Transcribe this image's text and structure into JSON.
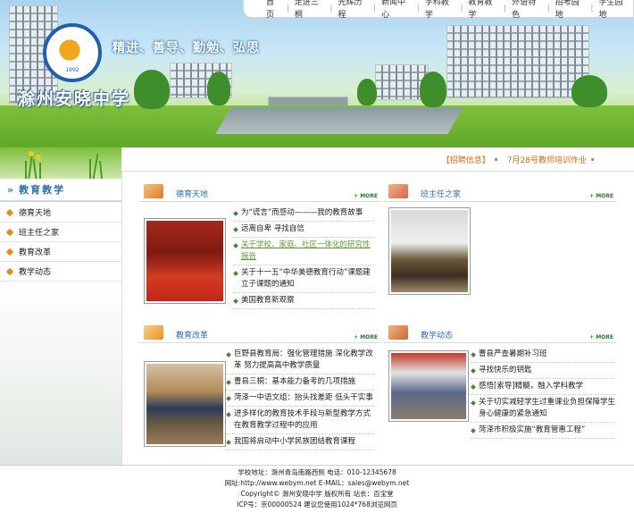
{
  "header": {
    "motto": "精进、善导、勤勉、弘思",
    "school_name": "滁州安晓中学",
    "logo_year": "1992"
  },
  "top_nav": [
    "首页",
    "走进三桐",
    "光辉历程",
    "新闻中心",
    "学科教学",
    "教育教学",
    "外语特色",
    "招考园地",
    "学生园地"
  ],
  "notice": {
    "label": "【招聘信息】",
    "item": "7月28号教师培训作业"
  },
  "sidebar": {
    "title": "教育教学",
    "items": [
      "德育天地",
      "班主任之家",
      "教育改革",
      "教学动态"
    ]
  },
  "sections": {
    "deyu": {
      "title": "德育天地",
      "more": "MORE",
      "items": [
        "为“谎言”而感动———我的教育故事",
        "远离自卑 寻找自信",
        "关于学校、家庭、社区一体化的研究性报告",
        "关于十一五“中华美德教育行动”课题建立子课题的通知",
        "美国教育新观察"
      ]
    },
    "banzhuren": {
      "title": "班主任之家",
      "more": "MORE"
    },
    "gaige": {
      "title": "教育改革",
      "more": "MORE",
      "items": [
        "巨野县教育局：强化管理措施 深化教学改革 努力提高高中教学质量",
        "曹县三桐：基本能力备考的几项措施",
        "菏泽一中语文组：抬头找差距 低头干实事",
        "进多样化的教育技术手段与新型教学方式在教育教学过程中的应用",
        "我国将启动中小学民族团结教育课程"
      ]
    },
    "dongtai": {
      "title": "教学动态",
      "more": "MORE",
      "items": [
        "曹县严查暑期补习班",
        "寻找快乐的钥匙",
        "感悟[索导]精髓，融入学科教学",
        "关于切实减轻学生过重课业负担保障学生身心健康的紧急通知",
        "菏泽市积极实施“教育管惠工程”"
      ]
    }
  },
  "footer": {
    "line1": "学校地址：滁州青岛南路西侧  电话：010-12345678",
    "line2": "网址:http://www.webym.net  E-MAIL：sales@webym.net",
    "line3": "Copyright© 滁州安晓中学 版权所有 站长：百宝堂",
    "line4": "ICP号：京00000524  建议您使用1024*768浏览网页"
  }
}
